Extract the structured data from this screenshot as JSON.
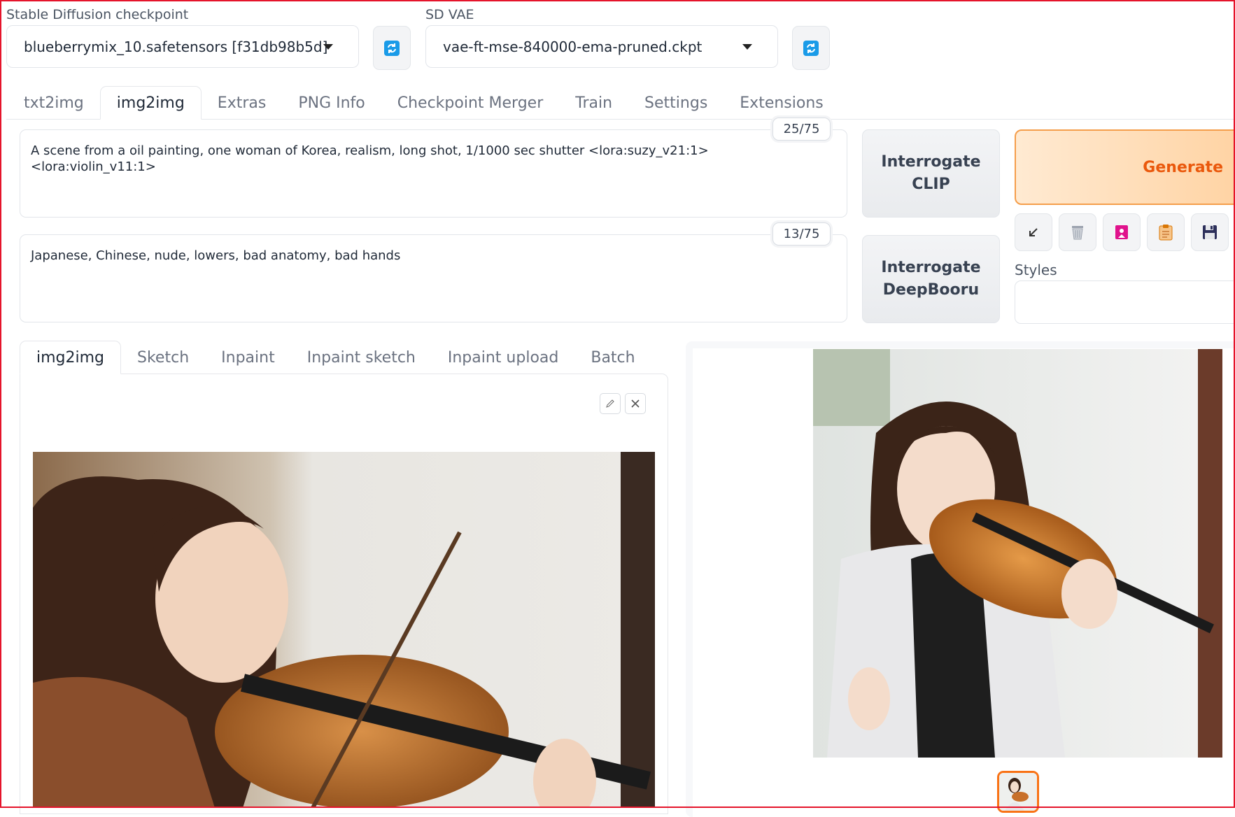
{
  "checkpoint": {
    "label": "Stable Diffusion checkpoint",
    "value": "blueberrymix_10.safetensors [f31db98b5d]",
    "refresh_icon": "refresh-icon"
  },
  "vae": {
    "label": "SD VAE",
    "value": "vae-ft-mse-840000-ema-pruned.ckpt",
    "refresh_icon": "refresh-icon"
  },
  "main_tabs": [
    {
      "label": "txt2img",
      "active": false
    },
    {
      "label": "img2img",
      "active": true
    },
    {
      "label": "Extras",
      "active": false
    },
    {
      "label": "PNG Info",
      "active": false
    },
    {
      "label": "Checkpoint Merger",
      "active": false
    },
    {
      "label": "Train",
      "active": false
    },
    {
      "label": "Settings",
      "active": false
    },
    {
      "label": "Extensions",
      "active": false
    }
  ],
  "prompt": {
    "value": "A scene from a oil painting, one woman of Korea, realism, long shot, 1/1000 sec shutter <lora:suzy_v21:1> <lora:violin_v11:1>",
    "token_count": "25/75"
  },
  "negative_prompt": {
    "value": "Japanese, Chinese, nude, lowers, bad anatomy, bad hands",
    "token_count": "13/75"
  },
  "buttons": {
    "interrogate_clip": [
      "Interrogate",
      "CLIP"
    ],
    "interrogate_deepbooru": [
      "Interrogate",
      "DeepBooru"
    ],
    "generate": "Generate"
  },
  "tool_buttons": [
    {
      "icon": "arrow-down-left-icon"
    },
    {
      "icon": "trash-icon"
    },
    {
      "icon": "bookmark-icon"
    },
    {
      "icon": "clipboard-icon"
    },
    {
      "icon": "save-icon"
    }
  ],
  "styles": {
    "label": "Styles",
    "value": ""
  },
  "sub_tabs": [
    {
      "label": "img2img",
      "active": true
    },
    {
      "label": "Sketch",
      "active": false
    },
    {
      "label": "Inpaint",
      "active": false
    },
    {
      "label": "Inpaint sketch",
      "active": false
    },
    {
      "label": "Inpaint upload",
      "active": false
    },
    {
      "label": "Batch",
      "active": false
    }
  ],
  "image_tools": {
    "edit_icon": "pencil-icon",
    "clear_icon": "close-icon"
  },
  "colors": {
    "accent_orange": "#ea580c",
    "generate_bg": "#ffd3a3",
    "refresh_blue": "#1a9be8",
    "frame_red": "#e5142b"
  }
}
